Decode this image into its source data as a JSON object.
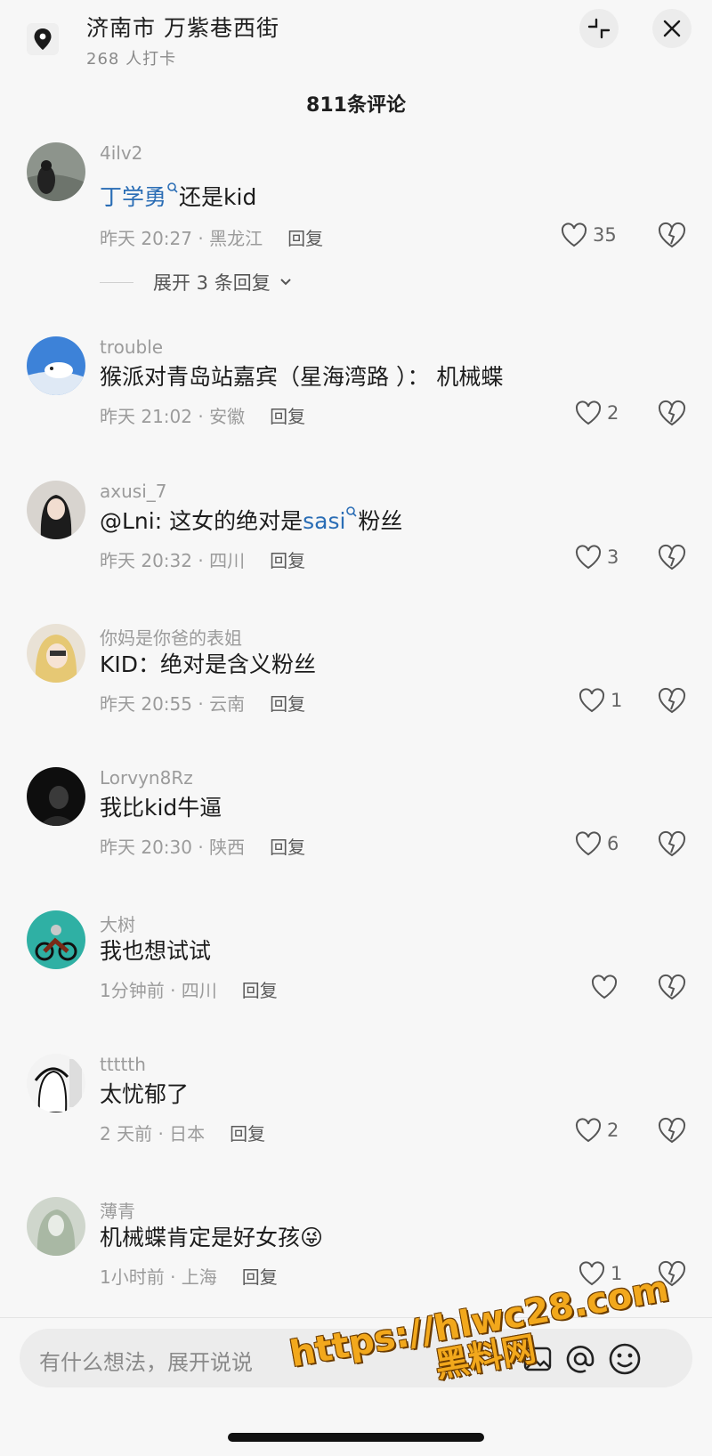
{
  "header": {
    "location_title": "济南市  万紫巷西街",
    "checkins": "268 人打卡",
    "comment_count": "811条评论"
  },
  "comments": [
    {
      "user": "4ilv2",
      "mention": "丁学勇",
      "text": "还是kid",
      "time": "昨天 20:27 · 黑龙江",
      "reply": "回复",
      "likes": "35",
      "expand": "展开 3 条回复"
    },
    {
      "user": "trouble",
      "text": "猴派对青岛站嘉宾（星海湾路 ）： 机械蝶",
      "time": "昨天 21:02 · 安徽",
      "reply": "回复",
      "likes": "2"
    },
    {
      "user": "axusi_7",
      "prefix": "@Lni: 这女的绝对是",
      "mention": "sasi",
      "text": "粉丝",
      "time": "昨天 20:32 · 四川",
      "reply": "回复",
      "likes": "3"
    },
    {
      "user": "你妈是你爸的表姐",
      "text": "KID：绝对是含义粉丝",
      "time": "昨天 20:55 · 云南",
      "reply": "回复",
      "likes": "1"
    },
    {
      "user": "Lorvyn8Rz",
      "text": "我比kid牛逼",
      "time": "昨天 20:30 · 陕西",
      "reply": "回复",
      "likes": "6"
    },
    {
      "user": "大树",
      "text": "我也想试试",
      "time": "1分钟前 · 四川",
      "reply": "回复",
      "likes": ""
    },
    {
      "user": "ttttth",
      "text": "太忧郁了",
      "time": "2 天前 · 日本",
      "reply": "回复",
      "likes": "2"
    },
    {
      "user": "薄青",
      "text": "机械蝶肯定是好女孩😜",
      "time": "1小时前 · 上海",
      "reply": "回复",
      "likes": "1"
    }
  ],
  "input": {
    "placeholder": "有什么想法，展开说说"
  },
  "watermark": {
    "line1": "https://hlwc28.com",
    "line2": "黑料网"
  },
  "colors": {
    "mention": "#2a6db5",
    "watermark": "#f2a81c"
  }
}
